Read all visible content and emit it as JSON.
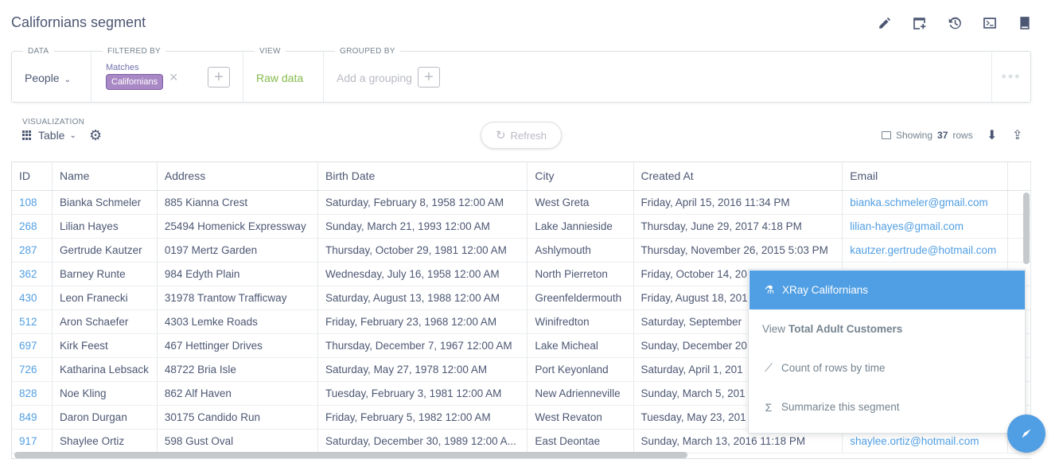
{
  "header": {
    "title": "Californians segment",
    "icons": [
      "pencil-icon",
      "add-to-dashboard-icon",
      "history-icon",
      "sql-icon",
      "bookmark-icon"
    ]
  },
  "query": {
    "data_label": "DATA",
    "data_value": "People",
    "filter_label": "FILTERED BY",
    "filter_matches": "Matches",
    "filter_value": "Californians",
    "view_label": "VIEW",
    "view_value": "Raw data",
    "group_label": "GROUPED BY",
    "group_placeholder": "Add a grouping"
  },
  "viz": {
    "label": "VISUALIZATION",
    "value": "Table"
  },
  "refresh_label": "Refresh",
  "rows": {
    "prefix": "Showing",
    "count": "37",
    "suffix": "rows"
  },
  "table": {
    "columns": [
      "ID",
      "Name",
      "Address",
      "Birth Date",
      "City",
      "Created At",
      "Email"
    ],
    "rows": [
      [
        "108",
        "Bianka Schmeler",
        "885 Kianna Crest",
        "Saturday, February 8, 1958 12:00 AM",
        "West Greta",
        "Friday, April 15, 2016 11:34 PM",
        "bianka.schmeler@gmail.com"
      ],
      [
        "268",
        "Lilian Hayes",
        "25494 Homenick Expressway",
        "Sunday, March 21, 1993 12:00 AM",
        "Lake Jannieside",
        "Thursday, June 29, 2017 4:18 PM",
        "lilian-hayes@gmail.com"
      ],
      [
        "287",
        "Gertrude Kautzer",
        "0197 Mertz Garden",
        "Thursday, October 29, 1981 12:00 AM",
        "Ashlymouth",
        "Thursday, November 26, 2015 5:03 PM",
        "kautzer.gertrude@hotmail.com"
      ],
      [
        "362",
        "Barney Runte",
        "984 Edyth Plain",
        "Wednesday, July 16, 1958 12:00 AM",
        "North Pierreton",
        "Friday, October 14, 2016",
        ""
      ],
      [
        "430",
        "Leon Franecki",
        "31978 Trantow Trafficway",
        "Saturday, August 13, 1988 12:00 AM",
        "Greenfeldermouth",
        "Friday, August 18, 2017",
        ""
      ],
      [
        "512",
        "Aron Schaefer",
        "4303 Lemke Roads",
        "Friday, February 23, 1968 12:00 AM",
        "Winifredton",
        "Saturday, September",
        ""
      ],
      [
        "697",
        "Kirk Feest",
        "467 Hettinger Drives",
        "Thursday, December 7, 1967 12:00 AM",
        "Lake Micheal",
        "Sunday, December 20",
        ""
      ],
      [
        "726",
        "Katharina Lebsack",
        "48722 Bria Isle",
        "Saturday, May 27, 1978 12:00 AM",
        "Port Keyonland",
        "Saturday, April 1, 201",
        ""
      ],
      [
        "828",
        "Noe Kling",
        "862 Alf Haven",
        "Tuesday, February 3, 1981 12:00 AM",
        "New Adrienneville",
        "Sunday, March 5, 201",
        ""
      ],
      [
        "849",
        "Daron Durgan",
        "30175 Candido Run",
        "Friday, February 5, 1982 12:00 AM",
        "West Revaton",
        "Tuesday, May 23, 201",
        ""
      ],
      [
        "917",
        "Shaylee Ortiz",
        "598 Gust Oval",
        "Saturday, December 30, 1989 12:00 A...",
        "East Deontae",
        "Sunday, March 13, 2016 11:18 PM",
        "shaylee.ortiz@hotmail.com"
      ]
    ]
  },
  "popover": {
    "xray": "XRay Californians",
    "view_prefix": "View",
    "view_target": "Total Adult Customers",
    "count_by_time": "Count of rows by time",
    "summarize": "Summarize this segment"
  },
  "colors": {
    "brand": "#509ee3",
    "filter": "#a989c5",
    "view": "#84bb4c"
  }
}
